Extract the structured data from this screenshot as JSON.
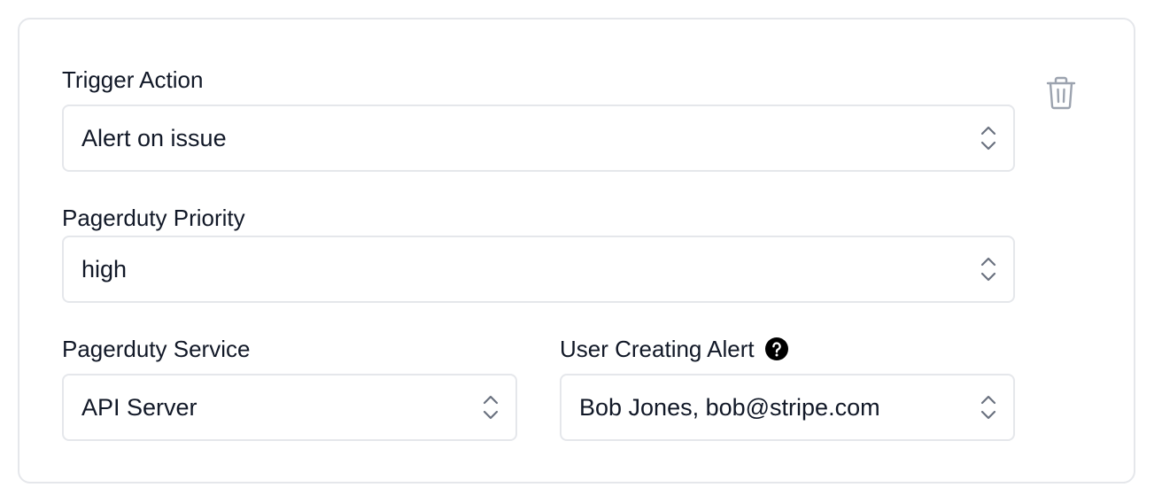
{
  "form": {
    "trigger_action": {
      "label": "Trigger Action",
      "value": "Alert on issue"
    },
    "pagerduty_priority": {
      "label": "Pagerduty Priority",
      "value": "high"
    },
    "pagerduty_service": {
      "label": "Pagerduty Service",
      "value": "API Server"
    },
    "user_creating_alert": {
      "label": "User Creating Alert",
      "value": "Bob Jones, bob@stripe.com"
    }
  },
  "icons": {
    "chevrons": "chevron-up-down-icon",
    "help": "question-circle-icon",
    "delete": "trash-icon"
  },
  "colors": {
    "border": "#e5e7eb",
    "text": "#111827",
    "icon_muted": "#9ca3af",
    "help_icon": "#000000"
  }
}
